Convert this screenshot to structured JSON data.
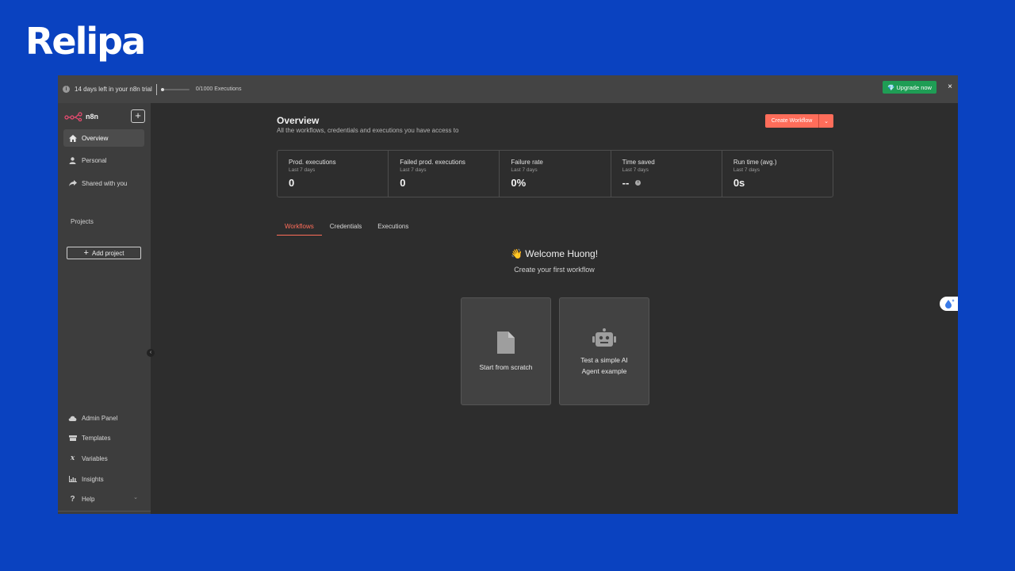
{
  "brand": {
    "logo_text": "Relipa"
  },
  "banner": {
    "trial_text": "14 days left in your n8n trial",
    "executions_text": "0/1000 Executions",
    "upgrade_label": "Upgrade now",
    "close_label": "×"
  },
  "sidebar": {
    "logo_text": "n8n",
    "add_label": "+",
    "nav": [
      {
        "label": "Overview",
        "icon": "home-icon",
        "active": true
      },
      {
        "label": "Personal",
        "icon": "user-icon"
      },
      {
        "label": "Shared with you",
        "icon": "share-icon"
      }
    ],
    "projects_heading": "Projects",
    "add_project_label": "Add project",
    "bottom": [
      {
        "label": "Admin Panel",
        "icon": "cloud-icon"
      },
      {
        "label": "Templates",
        "icon": "box-icon"
      },
      {
        "label": "Variables",
        "icon": "variable-icon"
      },
      {
        "label": "Insights",
        "icon": "chart-icon"
      },
      {
        "label": "Help",
        "icon": "question-icon"
      }
    ]
  },
  "main": {
    "title": "Overview",
    "subtitle": "All the workflows, credentials and executions you have access to",
    "create_label": "Create Workflow",
    "stats": [
      {
        "label": "Prod. executions",
        "period": "Last 7 days",
        "value": "0"
      },
      {
        "label": "Failed prod. executions",
        "period": "Last 7 days",
        "value": "0"
      },
      {
        "label": "Failure rate",
        "period": "Last 7 days",
        "value": "0%"
      },
      {
        "label": "Time saved",
        "period": "Last 7 days",
        "value": "--"
      },
      {
        "label": "Run time (avg.)",
        "period": "Last 7 days",
        "value": "0s"
      }
    ],
    "tabs": [
      "Workflows",
      "Credentials",
      "Executions"
    ],
    "welcome": "👋 Welcome Huong!",
    "welcome_sub": "Create your first workflow",
    "cards": [
      {
        "label": "Start from scratch"
      },
      {
        "label_line1": "Test a simple AI",
        "label_line2": "Agent example"
      }
    ]
  },
  "colors": {
    "accent": "#ff6d5a",
    "upgrade": "#1f9d55",
    "background": "#0a42c0"
  }
}
